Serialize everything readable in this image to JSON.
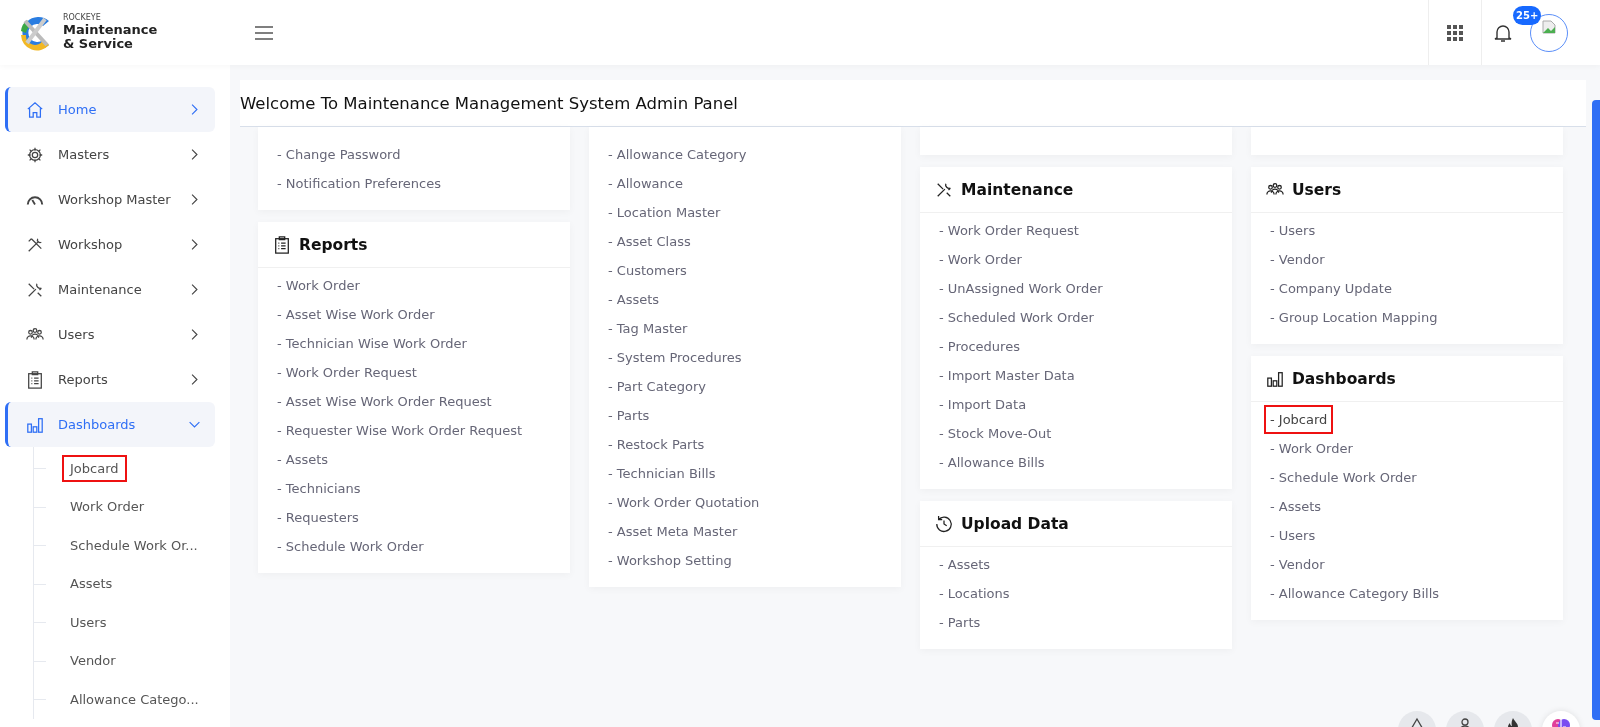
{
  "brand": {
    "company": "ROCKEYE",
    "name_line1": "Maintenance",
    "name_line2": "& Service"
  },
  "header": {
    "notification_count": "25+"
  },
  "sidebar": {
    "items": [
      {
        "label": "Home",
        "kind": "home",
        "active": true,
        "expanded": false
      },
      {
        "label": "Masters",
        "kind": "gear",
        "active": false,
        "expanded": false
      },
      {
        "label": "Workshop Master",
        "kind": "gauge",
        "active": false,
        "expanded": false
      },
      {
        "label": "Workshop",
        "kind": "tools",
        "active": false,
        "expanded": false
      },
      {
        "label": "Maintenance",
        "kind": "wrench",
        "active": false,
        "expanded": false
      },
      {
        "label": "Users",
        "kind": "users",
        "active": false,
        "expanded": false
      },
      {
        "label": "Reports",
        "kind": "clipboard",
        "active": false,
        "expanded": false
      },
      {
        "label": "Dashboards",
        "kind": "chart",
        "active": true,
        "expanded": true,
        "children": [
          {
            "label": "Jobcard",
            "highlighted": true
          },
          {
            "label": "Work Order",
            "highlighted": false
          },
          {
            "label": "Schedule Work Or...",
            "highlighted": false
          },
          {
            "label": "Assets",
            "highlighted": false
          },
          {
            "label": "Users",
            "highlighted": false
          },
          {
            "label": "Vendor",
            "highlighted": false
          },
          {
            "label": "Allowance Catego...",
            "highlighted": false
          }
        ]
      }
    ]
  },
  "page_title": "Welcome To Maintenance Management System Admin Panel",
  "columns": [
    {
      "cards": [
        {
          "kind": "cut",
          "items": [
            {
              "label": "- Change Password"
            },
            {
              "label": "- Notification Preferences"
            }
          ]
        },
        {
          "title": "Reports",
          "kind": "clipboard",
          "items": [
            {
              "label": "- Work Order"
            },
            {
              "label": "- Asset Wise Work Order"
            },
            {
              "label": "- Technician Wise Work Order"
            },
            {
              "label": "- Work Order Request"
            },
            {
              "label": "- Asset Wise Work Order Request"
            },
            {
              "label": "- Requester Wise Work Order Request"
            },
            {
              "label": "- Assets"
            },
            {
              "label": "- Technicians"
            },
            {
              "label": "- Requesters"
            },
            {
              "label": "- Schedule Work Order"
            }
          ]
        }
      ]
    },
    {
      "cards": [
        {
          "kind": "cut",
          "items": [
            {
              "label": "- Allowance Category"
            },
            {
              "label": "- Allowance"
            },
            {
              "label": "- Location Master"
            },
            {
              "label": "- Asset Class"
            },
            {
              "label": "- Customers"
            },
            {
              "label": "- Assets"
            },
            {
              "label": "- Tag Master"
            },
            {
              "label": "- System Procedures"
            },
            {
              "label": "- Part Category"
            },
            {
              "label": "- Parts"
            },
            {
              "label": "- Restock Parts"
            },
            {
              "label": "- Technician Bills"
            },
            {
              "label": "- Work Order Quotation"
            },
            {
              "label": "- Asset Meta Master"
            },
            {
              "label": "- Workshop Setting"
            }
          ]
        }
      ]
    },
    {
      "cards": [
        {
          "kind": "cut"
        },
        {
          "title": "Maintenance",
          "kind": "wrench",
          "items": [
            {
              "label": "- Work Order Request"
            },
            {
              "label": "- Work Order"
            },
            {
              "label": "- UnAssigned Work Order"
            },
            {
              "label": "- Scheduled Work Order"
            },
            {
              "label": "- Procedures"
            },
            {
              "label": "- Import Master Data"
            },
            {
              "label": "- Import Data"
            },
            {
              "label": "- Stock Move-Out"
            },
            {
              "label": "- Allowance Bills"
            }
          ]
        },
        {
          "title": "Upload Data",
          "kind": "history",
          "items": [
            {
              "label": "- Assets"
            },
            {
              "label": "- Locations"
            },
            {
              "label": "- Parts"
            }
          ]
        }
      ]
    },
    {
      "cards": [
        {
          "kind": "cut"
        },
        {
          "title": "Users",
          "kind": "users",
          "items": [
            {
              "label": "- Users"
            },
            {
              "label": "- Vendor"
            },
            {
              "label": "- Company Update"
            },
            {
              "label": "- Group Location Mapping"
            }
          ]
        },
        {
          "title": "Dashboards",
          "kind": "chart",
          "items": [
            {
              "label": "- Jobcard",
              "highlighted": true
            },
            {
              "label": "- Work Order",
              "highlighted": false
            },
            {
              "label": "- Schedule Work Order",
              "highlighted": false
            },
            {
              "label": "- Assets",
              "highlighted": false
            },
            {
              "label": "- Users",
              "highlighted": false
            },
            {
              "label": "- Vendor",
              "highlighted": false
            },
            {
              "label": "- Allowance Category Bills",
              "highlighted": false
            }
          ]
        }
      ]
    }
  ]
}
